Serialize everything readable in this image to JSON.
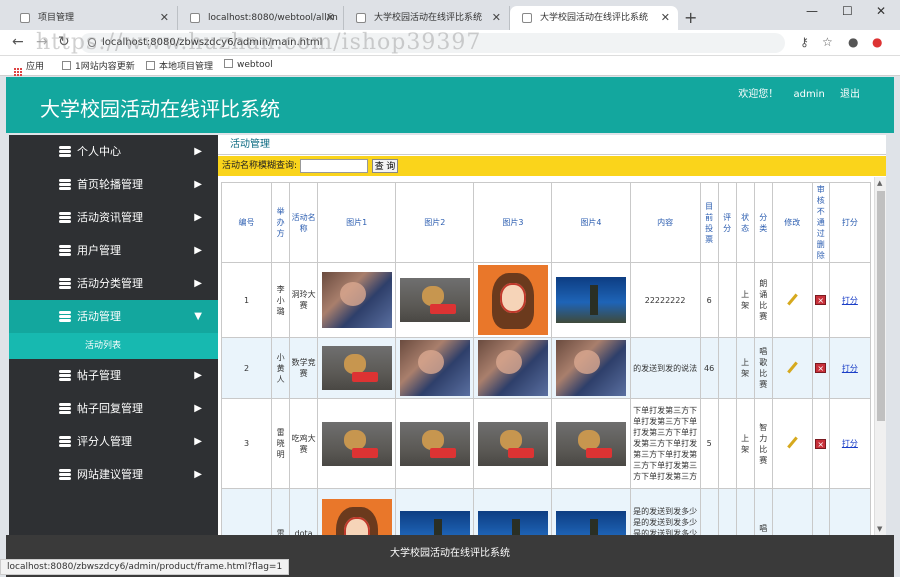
{
  "browser": {
    "tabs": [
      {
        "title": "项目管理",
        "active": false
      },
      {
        "title": "localhost:8080/webtool/all/in",
        "active": false
      },
      {
        "title": "大学校园活动在线评比系统",
        "active": false
      },
      {
        "title": "大学校园活动在线评比系统",
        "active": true
      }
    ],
    "new_tab": "+",
    "url": "localhost:8080/zbwszdcy6/admin/main.html",
    "bookmarks": [
      "应用",
      "1网站内容更新",
      "本地项目管理",
      "webtool"
    ],
    "watermark": "https://www.huzhan.com/ishop39397",
    "status_url": "localhost:8080/zbwszdcy6/admin/product/frame.html?flag=1"
  },
  "header": {
    "title": "大学校园活动在线评比系统",
    "welcome": "欢迎您！",
    "user": "admin",
    "logout": "退出",
    "bg_color": "#13a79e"
  },
  "sidebar": {
    "items": [
      {
        "label": "个人中心",
        "chevron": "▶"
      },
      {
        "label": "首页轮播管理",
        "chevron": "▶"
      },
      {
        "label": "活动资讯管理",
        "chevron": "▶"
      },
      {
        "label": "用户管理",
        "chevron": "▶"
      },
      {
        "label": "活动分类管理",
        "chevron": "▶"
      },
      {
        "label": "活动管理",
        "chevron": "▼",
        "active": true
      },
      {
        "label": "帖子管理",
        "chevron": "▶"
      },
      {
        "label": "帖子回复管理",
        "chevron": "▶"
      },
      {
        "label": "评分人管理",
        "chevron": "▶"
      },
      {
        "label": "网站建议管理",
        "chevron": "▶"
      }
    ],
    "subitem": "活动列表"
  },
  "main": {
    "section_title": "活动管理",
    "search_label": "活动名称模糊查询:",
    "search_value": "",
    "search_button": "查 询",
    "columns": [
      "编号",
      "举办方",
      "活动名称",
      "图片1",
      "图片2",
      "图片3",
      "图片4",
      "内容",
      "目前投票",
      "评分",
      "状态",
      "分类",
      "修改",
      "审核不通过删除",
      "打分"
    ],
    "rows": [
      {
        "id": "1",
        "organizer": "李小璐",
        "name": "洞玲大赛",
        "content": "22222222",
        "votes": "6",
        "score": "",
        "status": "上架",
        "category": "朗诵比赛",
        "rate": "打分"
      },
      {
        "id": "2",
        "organizer": "小黄人",
        "name": "数学竞赛",
        "content": "的发送到发的说法",
        "votes": "46",
        "score": "",
        "status": "上架",
        "category": "唱歌比赛",
        "rate": "打分"
      },
      {
        "id": "3",
        "organizer": "雷晓明",
        "name": "吃鸡大赛",
        "content": "下单打发第三方下单打发第三方下单打发第三方下单打发第三方下单打发第三方下单打发第三方下单打发第三方下单打发第三方",
        "votes": "5",
        "score": "",
        "status": "上架",
        "category": "智力比赛",
        "rate": "打分"
      },
      {
        "id": "",
        "organizer": "雷",
        "name": "dota",
        "content": "是的发送到发多少是的发送到发多少是的发送到发多少是的发送到发多少是的发送",
        "votes": "",
        "score": "",
        "status": "",
        "category": "唱歌",
        "rate": ""
      }
    ]
  },
  "footer": {
    "text": "大学校园活动在线评比系统"
  }
}
